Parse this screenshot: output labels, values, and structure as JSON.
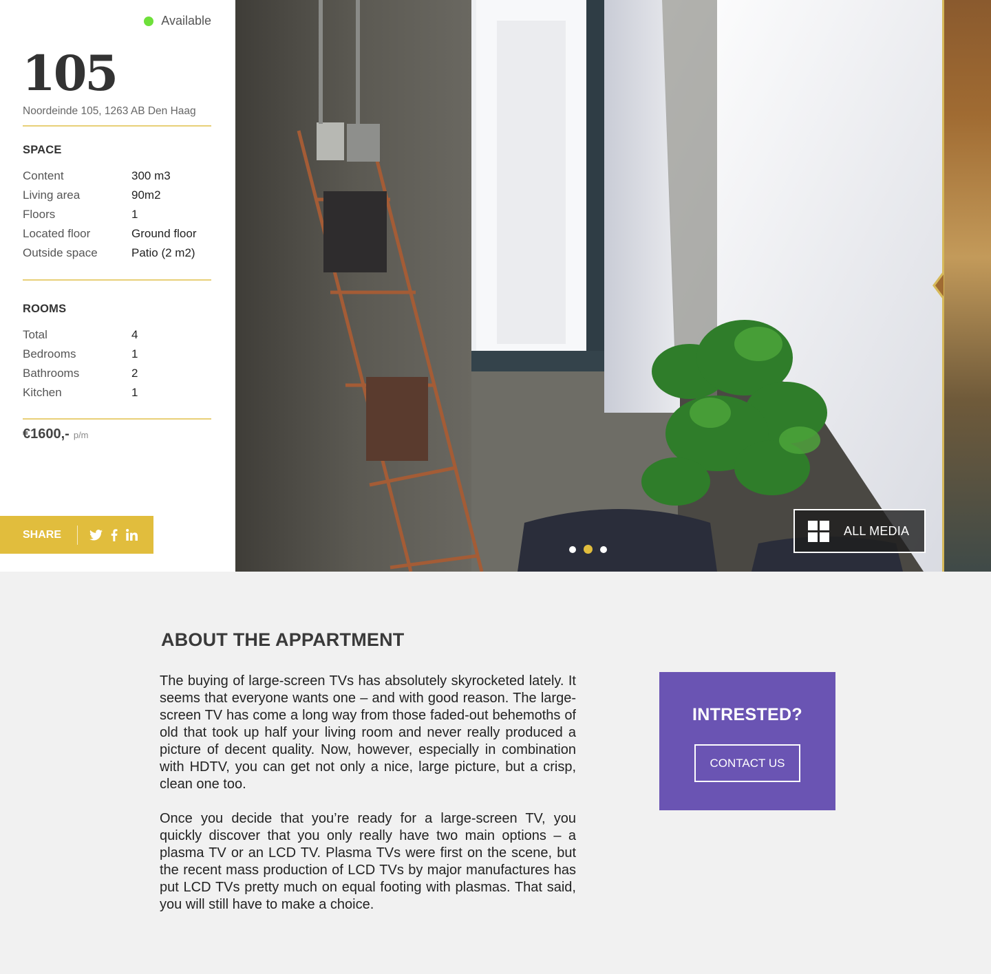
{
  "listing": {
    "status": "Available",
    "status_color": "#6ee03a",
    "unit_number": "105",
    "address": "Noordeinde 105, 1263 AB Den Haag"
  },
  "space": {
    "title": "SPACE",
    "rows": [
      {
        "label": "Content",
        "value": "300 m3"
      },
      {
        "label": "Living area",
        "value": "90m2"
      },
      {
        "label": "Floors",
        "value": "1"
      },
      {
        "label": "Located floor",
        "value": "Ground floor"
      },
      {
        "label": "Outside space",
        "value": "Patio (2 m2)"
      }
    ]
  },
  "rooms": {
    "title": "ROOMS",
    "rows": [
      {
        "label": "Total",
        "value": "4"
      },
      {
        "label": "Bedrooms",
        "value": "1"
      },
      {
        "label": "Bathrooms",
        "value": "2"
      },
      {
        "label": "Kitchen",
        "value": "1"
      }
    ]
  },
  "price": {
    "amount": "€1600,-",
    "unit": "p/m"
  },
  "share": {
    "label": "SHARE",
    "icons": [
      "twitter-icon",
      "facebook-icon",
      "linkedin-icon"
    ],
    "color": "#e1bd3d"
  },
  "gallery": {
    "slide_count": 3,
    "active_slide": 2,
    "all_media_label": "ALL MEDIA",
    "accent": "#e1bd3d"
  },
  "about": {
    "title": "ABOUT THE APPARTMENT",
    "paragraphs": [
      "The buying of large-screen TVs has absolutely skyrocketed lately. It seems that everyone wants one – and with good reason. The large-screen TV has come a long way from those faded-out behemoths of old that took up half your living room and never really produced a picture of decent quality. Now, however, especially in combination with HDTV, you can get not only a nice, large picture, but a crisp, clean one too.",
      "Once you decide that you’re ready for a large-screen TV, you quickly discover that you only really have two main options – a plasma TV or an LCD TV. Plasma TVs were first on the scene, but the recent mass production of LCD TVs by major manufactures has put LCD TVs pretty much on equal footing with plasmas. That said, you will still have to make a choice."
    ]
  },
  "cta": {
    "title": "INTRESTED?",
    "button_label": "CONTACT US",
    "background": "#6a54b3"
  }
}
